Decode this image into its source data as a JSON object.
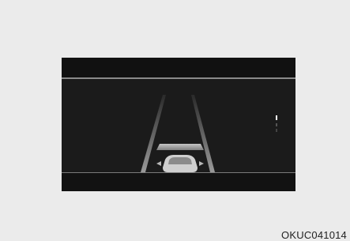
{
  "figure": {
    "caption": "OKUC041014"
  },
  "display": {
    "gauge_level": "high",
    "icons": [
      "road-lane-icon",
      "vehicle-icon",
      "gauge-icon"
    ]
  }
}
